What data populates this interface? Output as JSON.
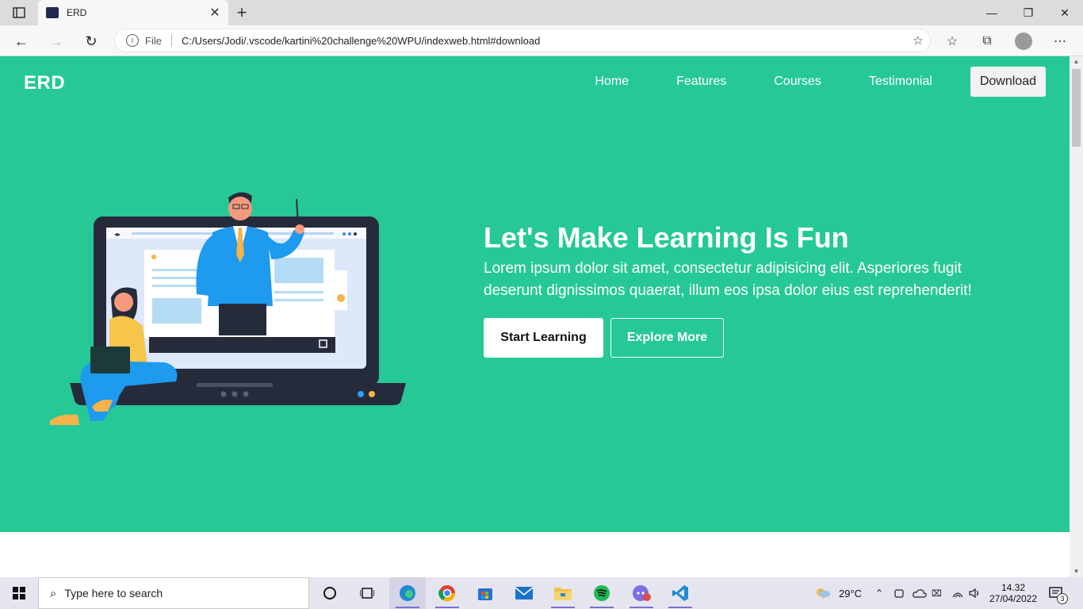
{
  "browser": {
    "tab_title": "ERD",
    "url_scheme_label": "File",
    "url": "C:/Users/Jodi/.vscode/kartini%20challenge%20WPU/indexweb.html#download"
  },
  "site": {
    "logo": "ERD",
    "nav": {
      "home": "Home",
      "features": "Features",
      "courses": "Courses",
      "testimonial": "Testimonial",
      "download": "Download"
    },
    "hero": {
      "headline": "Let's Make Learning Is Fun",
      "lead": "Lorem ipsum dolor sit amet, consectetur adipisicing elit. Asperiores fugit deserunt dignissimos quaerat, illum eos ipsa dolor eius est reprehenderit!",
      "primary_button": "Start Learning",
      "secondary_button": "Explore More"
    }
  },
  "taskbar": {
    "search_placeholder": "Type here to search",
    "weather": "29°C",
    "time": "14.32",
    "date": "27/04/2022",
    "notification_count": "3"
  },
  "colors": {
    "hero_bg": "#26c995",
    "accent": "#1f2a52"
  }
}
